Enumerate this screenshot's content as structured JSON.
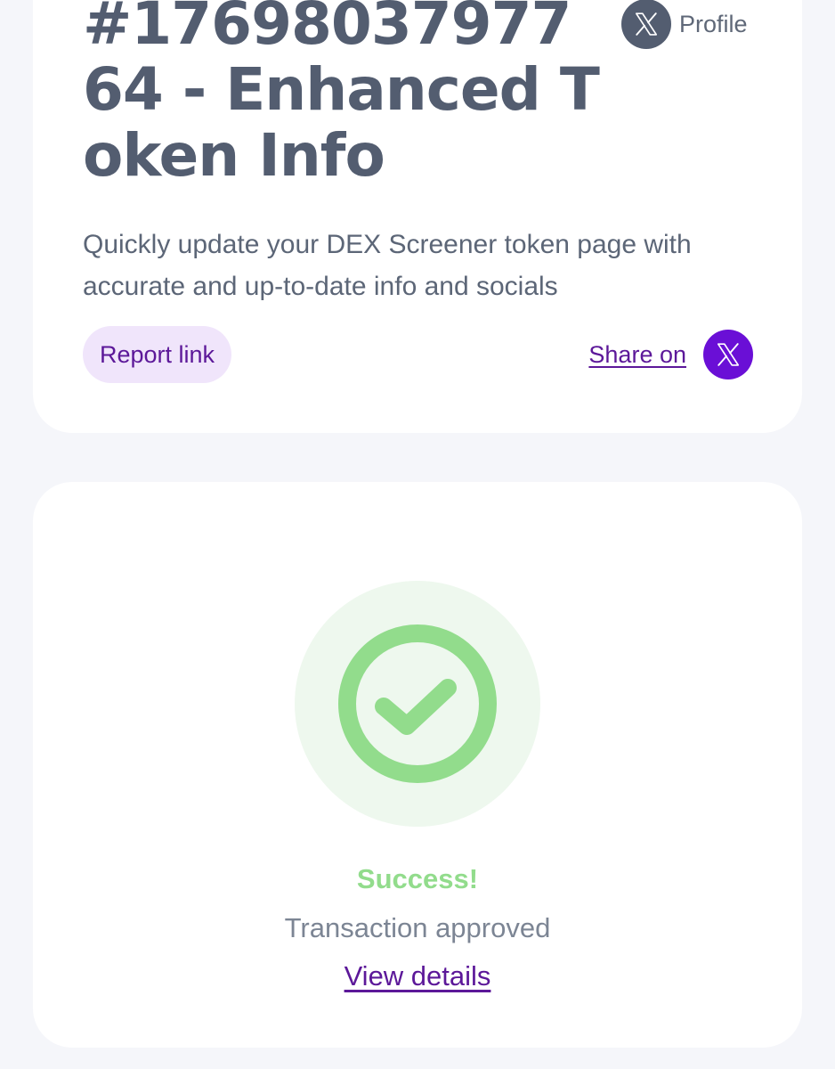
{
  "order": {
    "title": "#1769803797764 - Enhanced Token Info",
    "description": "Quickly update your DEX Screener token page with accurate and up-to-date info and socials"
  },
  "profile": {
    "label": "Profile",
    "icon": "x-logo-icon"
  },
  "actions": {
    "report_label": "Report link",
    "share_label": "Share on",
    "share_icon": "x-logo-icon"
  },
  "result": {
    "title": "Success!",
    "subtitle": "Transaction approved",
    "details_link": "View details",
    "icon": "check-circle-icon"
  },
  "colors": {
    "background": "#f5f6fa",
    "heading": "#535d70",
    "accent_purple": "#6a0fd6",
    "link_purple": "#5c1899",
    "report_bg": "#f0e5fb",
    "success_green": "#92dc8c",
    "success_halo": "#eef8ee"
  }
}
